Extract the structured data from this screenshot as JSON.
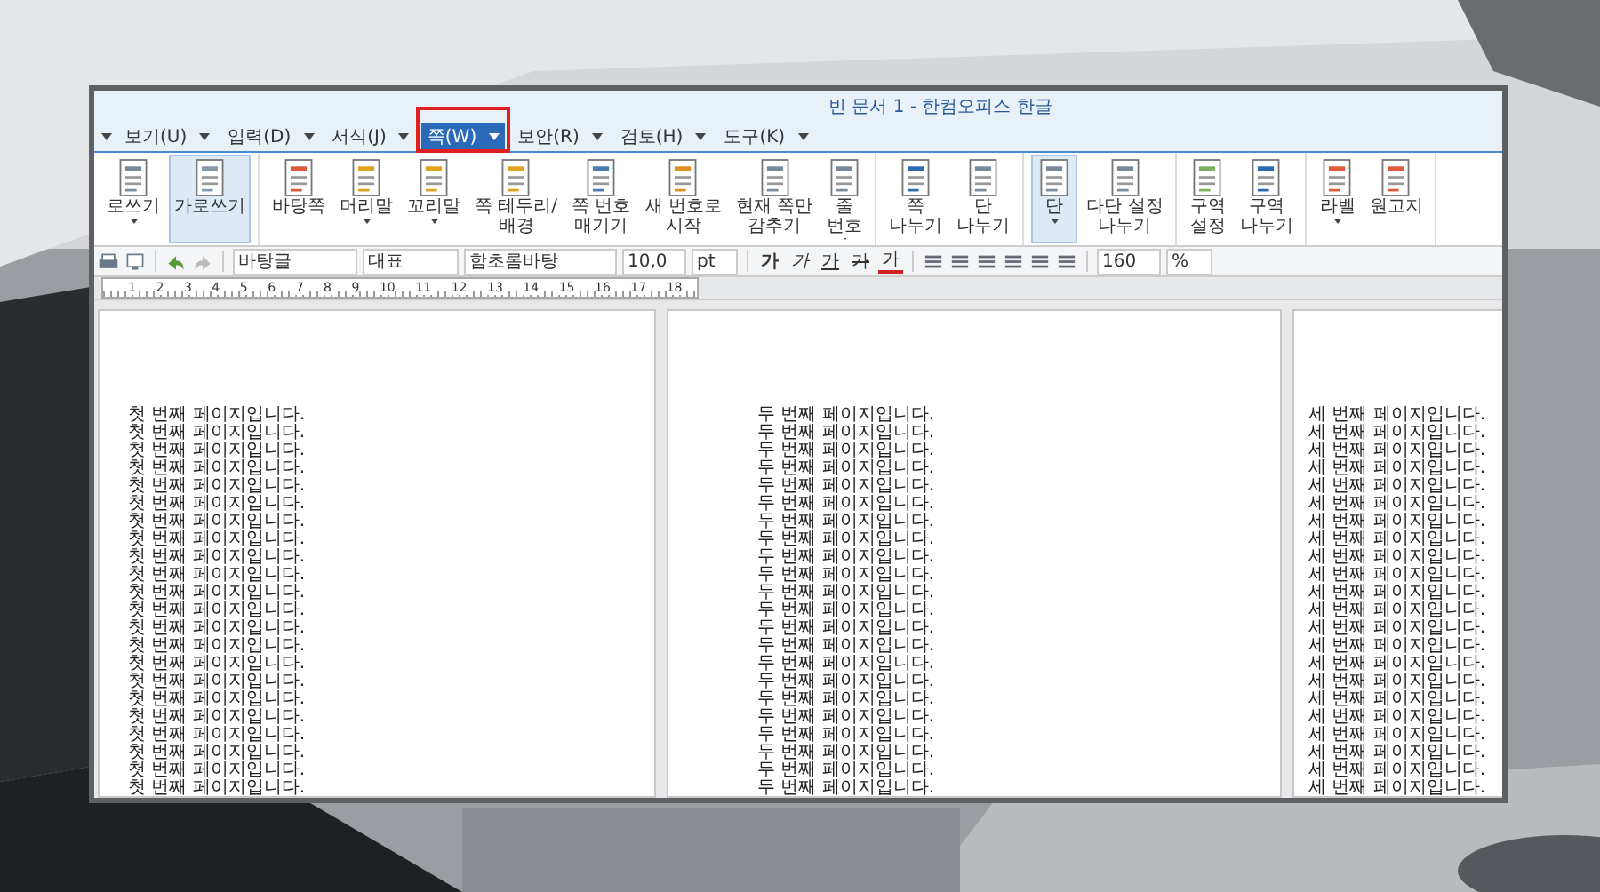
{
  "window": {
    "title": "빈 문서 1 - 한컴오피스 한글"
  },
  "menu": [
    {
      "label": "보기(U)",
      "selected": false
    },
    {
      "label": "입력(D)",
      "selected": false
    },
    {
      "label": "서식(J)",
      "selected": false
    },
    {
      "label": "쪽(W)",
      "selected": true
    },
    {
      "label": "보안(R)",
      "selected": false
    },
    {
      "label": "검토(H)",
      "selected": false
    },
    {
      "label": "도구(K)",
      "selected": false
    }
  ],
  "ribbon": {
    "groups": [
      [
        {
          "label": "로쓰기",
          "dropdown": true,
          "selected": false
        },
        {
          "label": "가로쓰기",
          "dropdown": false,
          "selected": true
        }
      ],
      [
        {
          "label": "바탕쪽",
          "dropdown": false,
          "selected": false
        },
        {
          "label": "머리말",
          "dropdown": true,
          "selected": false
        },
        {
          "label": "꼬리말",
          "dropdown": true,
          "selected": false
        },
        {
          "label": "쪽 테두리/\n배경",
          "dropdown": false,
          "selected": false
        },
        {
          "label": "쪽 번호\n매기기",
          "dropdown": false,
          "selected": false
        },
        {
          "label": "새 번호로\n시작",
          "dropdown": false,
          "selected": false
        },
        {
          "label": "현재 쪽만\n감추기",
          "dropdown": false,
          "selected": false
        },
        {
          "label": "줄\n번호",
          "dropdown": true,
          "selected": false
        }
      ],
      [
        {
          "label": "쪽\n나누기",
          "dropdown": false,
          "selected": false
        },
        {
          "label": "단\n나누기",
          "dropdown": false,
          "selected": false
        }
      ],
      [
        {
          "label": "단",
          "dropdown": true,
          "selected": true
        },
        {
          "label": "다단 설정\n나누기",
          "dropdown": false,
          "selected": false
        }
      ],
      [
        {
          "label": "구역\n설정",
          "dropdown": false,
          "selected": false
        },
        {
          "label": "구역\n나누기",
          "dropdown": false,
          "selected": false
        }
      ],
      [
        {
          "label": "라벨",
          "dropdown": true,
          "selected": false
        },
        {
          "label": "원고지",
          "dropdown": false,
          "selected": false
        }
      ]
    ]
  },
  "toolbar": {
    "style": "바탕글",
    "shape": "대표",
    "font": "함초롬바탕",
    "size": "10,0",
    "unit": "pt",
    "char_buttons": [
      {
        "label": "가",
        "kind": "bold"
      },
      {
        "label": "가",
        "kind": "italic"
      },
      {
        "label": "가",
        "kind": "underline"
      },
      {
        "label": "가",
        "kind": "strike"
      },
      {
        "label": "가",
        "kind": "color"
      }
    ],
    "zoom": "160",
    "zoom_unit": "%"
  },
  "ruler": {
    "marks": [
      "1",
      "2",
      "3",
      "4",
      "5",
      "6",
      "7",
      "8",
      "9",
      "10",
      "11",
      "12",
      "13",
      "14",
      "15",
      "16",
      "17",
      "18"
    ]
  },
  "pages": [
    {
      "lines": [
        "첫 번째 페이지입니다.",
        "첫 번째 페이지입니다.",
        "첫 번째 페이지입니다.",
        "첫 번째 페이지입니다.",
        "첫 번째 페이지입니다.",
        "첫 번째 페이지입니다.",
        "첫 번째 페이지입니다.",
        "첫 번째 페이지입니다.",
        "첫 번째 페이지입니다.",
        "첫 번째 페이지입니다.",
        "첫 번째 페이지입니다.",
        "첫 번째 페이지입니다.",
        "첫 번째 페이지입니다.",
        "첫 번째 페이지입니다.",
        "첫 번째 페이지입니다.",
        "첫 번째 페이지입니다.",
        "첫 번째 페이지입니다.",
        "첫 번째 페이지입니다.",
        "첫 번째 페이지입니다.",
        "첫 번째 페이지입니다.",
        "첫 번째 페이지입니다.",
        "첫 번째 페이지입니다."
      ]
    },
    {
      "lines": [
        "두 번째 페이지입니다.",
        "두 번째 페이지입니다.",
        "두 번째 페이지입니다.",
        "두 번째 페이지입니다.",
        "두 번째 페이지입니다.",
        "두 번째 페이지입니다.",
        "두 번째 페이지입니다.",
        "두 번째 페이지입니다.",
        "두 번째 페이지입니다.",
        "두 번째 페이지입니다.",
        "두 번째 페이지입니다.",
        "두 번째 페이지입니다.",
        "두 번째 페이지입니다.",
        "두 번째 페이지입니다.",
        "두 번째 페이지입니다.",
        "두 번째 페이지입니다.",
        "두 번째 페이지입니다.",
        "두 번째 페이지입니다.",
        "두 번째 페이지입니다.",
        "두 번째 페이지입니다.",
        "두 번째 페이지입니다.",
        "두 번째 페이지입니다."
      ]
    },
    {
      "lines": [
        "세 번째 페이지입니다.",
        "세 번째 페이지입니다.",
        "세 번째 페이지입니다.",
        "세 번째 페이지입니다.",
        "세 번째 페이지입니다.",
        "세 번째 페이지입니다.",
        "세 번째 페이지입니다.",
        "세 번째 페이지입니다.",
        "세 번째 페이지입니다.",
        "세 번째 페이지입니다.",
        "세 번째 페이지입니다.",
        "세 번째 페이지입니다.",
        "세 번째 페이지입니다.",
        "세 번째 페이지입니다.",
        "세 번째 페이지입니다.",
        "세 번째 페이지입니다.",
        "세 번째 페이지입니다.",
        "세 번째 페이지입니다.",
        "세 번째 페이지입니다.",
        "세 번째 페이지입니다.",
        "세 번째 페이지입니다.",
        "세 번째 페이지입니다."
      ]
    }
  ]
}
